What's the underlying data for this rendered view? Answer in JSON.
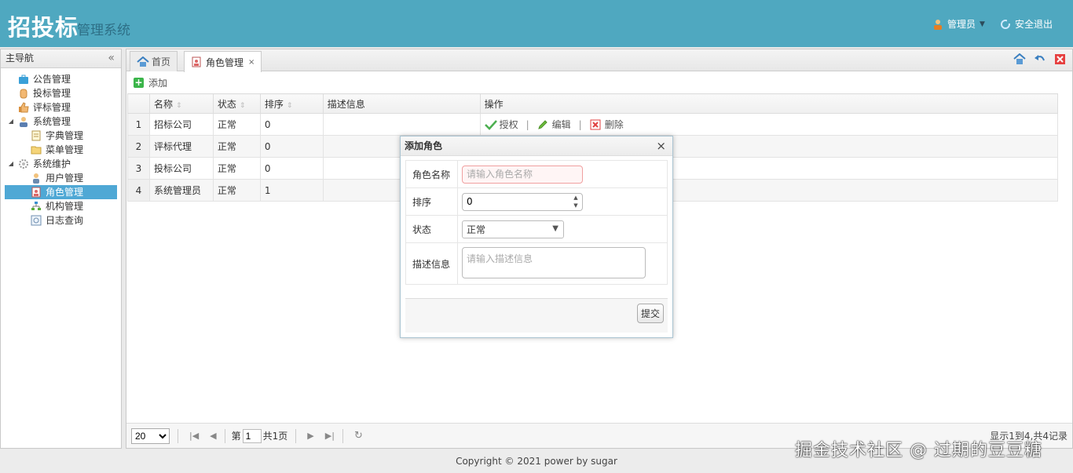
{
  "header": {
    "brand": "招投标",
    "brand_sub": "管理系统",
    "user": "管理员",
    "logout": "安全退出"
  },
  "sidebar": {
    "title": "主导航",
    "items": [
      {
        "label": "公告管理",
        "icon": "briefcase-icon"
      },
      {
        "label": "投标管理",
        "icon": "hand-icon"
      },
      {
        "label": "评标管理",
        "icon": "thumbs-up-icon"
      },
      {
        "label": "系统管理",
        "icon": "user-group-icon"
      },
      {
        "label": "字典管理",
        "icon": "document-icon"
      },
      {
        "label": "菜单管理",
        "icon": "folder-icon"
      },
      {
        "label": "系统维护",
        "icon": "gear-icon"
      },
      {
        "label": "用户管理",
        "icon": "user-icon"
      },
      {
        "label": "角色管理",
        "icon": "role-icon"
      },
      {
        "label": "机构管理",
        "icon": "org-chart-icon"
      },
      {
        "label": "日志查询",
        "icon": "log-icon"
      }
    ]
  },
  "tabs": [
    {
      "label": "首页"
    },
    {
      "label": "角色管理",
      "close": "×"
    }
  ],
  "toolbar": {
    "add_label": "添加"
  },
  "grid": {
    "columns": [
      "名称",
      "状态",
      "排序",
      "描述信息",
      "操作"
    ],
    "rows": [
      {
        "no": "1",
        "name": "招标公司",
        "status": "正常",
        "order": "0",
        "desc": ""
      },
      {
        "no": "2",
        "name": "评标代理",
        "status": "正常",
        "order": "0",
        "desc": ""
      },
      {
        "no": "3",
        "name": "投标公司",
        "status": "正常",
        "order": "0",
        "desc": ""
      },
      {
        "no": "4",
        "name": "系统管理员",
        "status": "正常",
        "order": "1",
        "desc": ""
      }
    ],
    "actions": {
      "grant": "授权",
      "edit": "编辑",
      "delete": "删除",
      "sep": "|"
    }
  },
  "pager": {
    "page_size": "20",
    "page_prefix": "第",
    "page_value": "1",
    "page_total": "共1页",
    "info": "显示1到4,共4记录"
  },
  "modal": {
    "title": "添加角色",
    "close": "×",
    "name_label": "角色名称",
    "name_placeholder": "请输入角色名称",
    "order_label": "排序",
    "order_value": "0",
    "status_label": "状态",
    "status_value": "正常",
    "desc_label": "描述信息",
    "desc_placeholder": "请输入描述信息",
    "submit": "提交"
  },
  "footer": {
    "copyright": "Copyright © 2021 power by sugar"
  },
  "watermark": "掘金技术社区 @ 过期的豆豆糖"
}
